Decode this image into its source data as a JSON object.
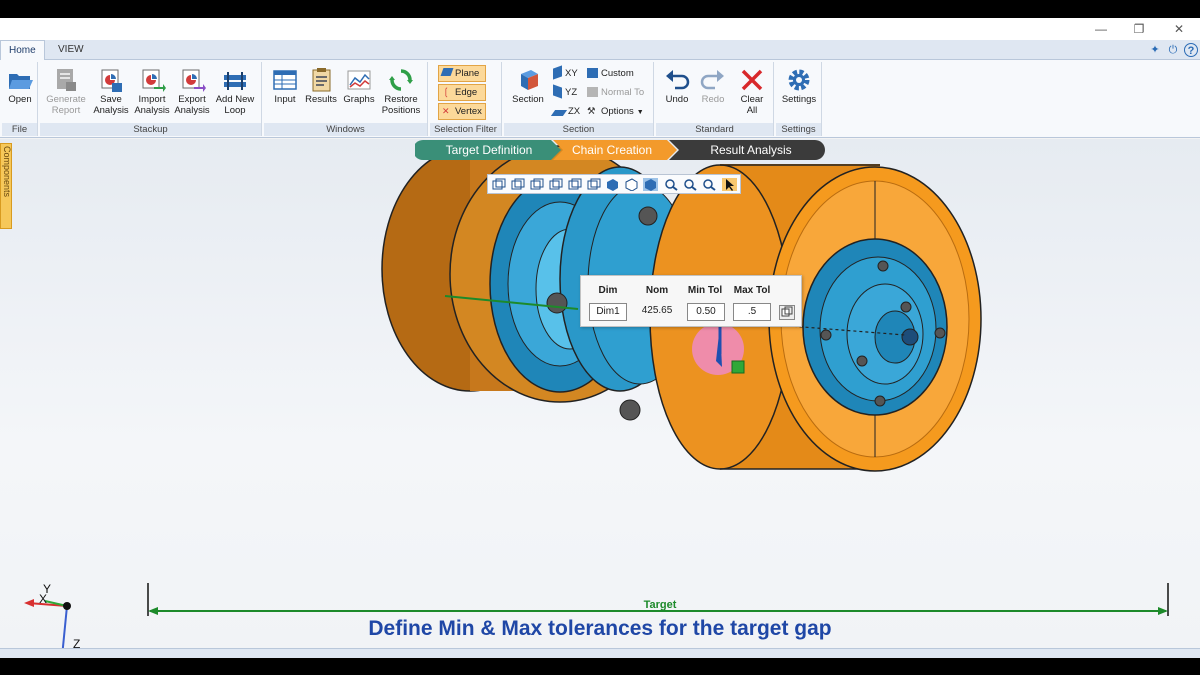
{
  "menu": {
    "tabs": [
      "Home",
      "VIEW"
    ]
  },
  "ribbon": {
    "groups": {
      "file": "File",
      "stackup": "Stackup",
      "windows": "Windows",
      "selection_filter": "Selection Filter",
      "section": "Section",
      "standard": "Standard",
      "settings": "Settings"
    },
    "open": "Open",
    "generate_report": [
      "Generate",
      "Report"
    ],
    "save_analysis": [
      "Save",
      "Analysis"
    ],
    "import_analysis": [
      "Import",
      "Analysis"
    ],
    "export_analysis": [
      "Export",
      "Analysis"
    ],
    "add_new_loop": [
      "Add New",
      "Loop"
    ],
    "input": "Input",
    "results": "Results",
    "graphs": "Graphs",
    "restore_positions": [
      "Restore",
      "Positions"
    ],
    "plane": "Plane",
    "edge": "Edge",
    "vertex": "Vertex",
    "section_btn": "Section",
    "xy": "XY",
    "yz": "YZ",
    "zx": "ZX",
    "custom": "Custom",
    "normal_to": "Normal To",
    "options": "Options",
    "undo": "Undo",
    "redo": "Redo",
    "clear_all": [
      "Clear",
      "All"
    ],
    "settings_btn": "Settings"
  },
  "side_tab": "Components",
  "workflow": {
    "steps": [
      "Target Definition",
      "Chain Creation",
      "Result Analysis"
    ],
    "colors": {
      "done": "#3a8f78",
      "active": "#f39a2b",
      "pending": "#3b3b3b"
    }
  },
  "tolerance_panel": {
    "headers": [
      "Dim",
      "Nom",
      "Min Tol",
      "Max Tol"
    ],
    "dim": "Dim1",
    "nom": "425.65",
    "min_tol": "0.50",
    "max_tol": ".5"
  },
  "target_label": "Target",
  "caption": "Define Min & Max tolerances for the target gap",
  "axes": {
    "y": "Y",
    "x": "X",
    "z": "Z"
  },
  "colors": {
    "orange_part": "#f59a1e",
    "blue_part": "#2f9fd0",
    "brown_part": "#c7781c",
    "caption": "#1f47a6",
    "target_line": "#1d8a2a"
  }
}
